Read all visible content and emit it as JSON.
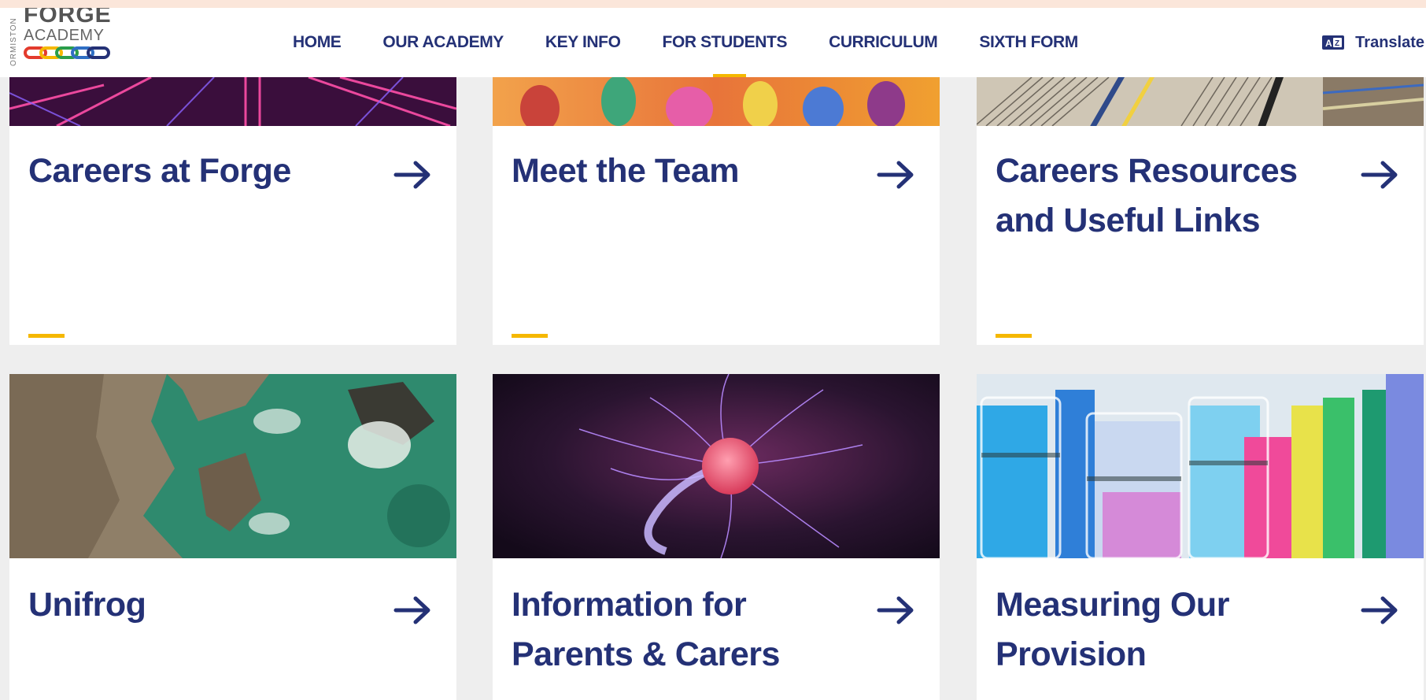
{
  "header": {
    "logo": {
      "side_text": "ORMISTON",
      "name": "FORGE",
      "sub": "ACADEMY"
    },
    "nav": [
      {
        "label": "HOME",
        "active": false
      },
      {
        "label": "OUR ACADEMY",
        "active": false
      },
      {
        "label": "KEY INFO",
        "active": false
      },
      {
        "label": "FOR STUDENTS",
        "active": true
      },
      {
        "label": "CURRICULUM",
        "active": false
      },
      {
        "label": "SIXTH FORM",
        "active": false
      }
    ],
    "translate": {
      "icon": "translate-icon",
      "label": "Translate"
    }
  },
  "cards": [
    {
      "title": "Careers at Forge",
      "image": "neon-light-lines"
    },
    {
      "title": "Meet the Team",
      "image": "painted-hands"
    },
    {
      "title": "Careers Resources and Useful Links",
      "image": "book-pages"
    },
    {
      "title": "Unifrog",
      "image": "coastline-aerial"
    },
    {
      "title": "Information for Parents & Carers",
      "image": "plasma-ball"
    },
    {
      "title": "Measuring Our Provision",
      "image": "test-tubes"
    }
  ],
  "colors": {
    "brand_navy": "#243176",
    "accent_yellow": "#f5b800",
    "page_background": "#eeeeee",
    "frame": "#fbe6da"
  }
}
